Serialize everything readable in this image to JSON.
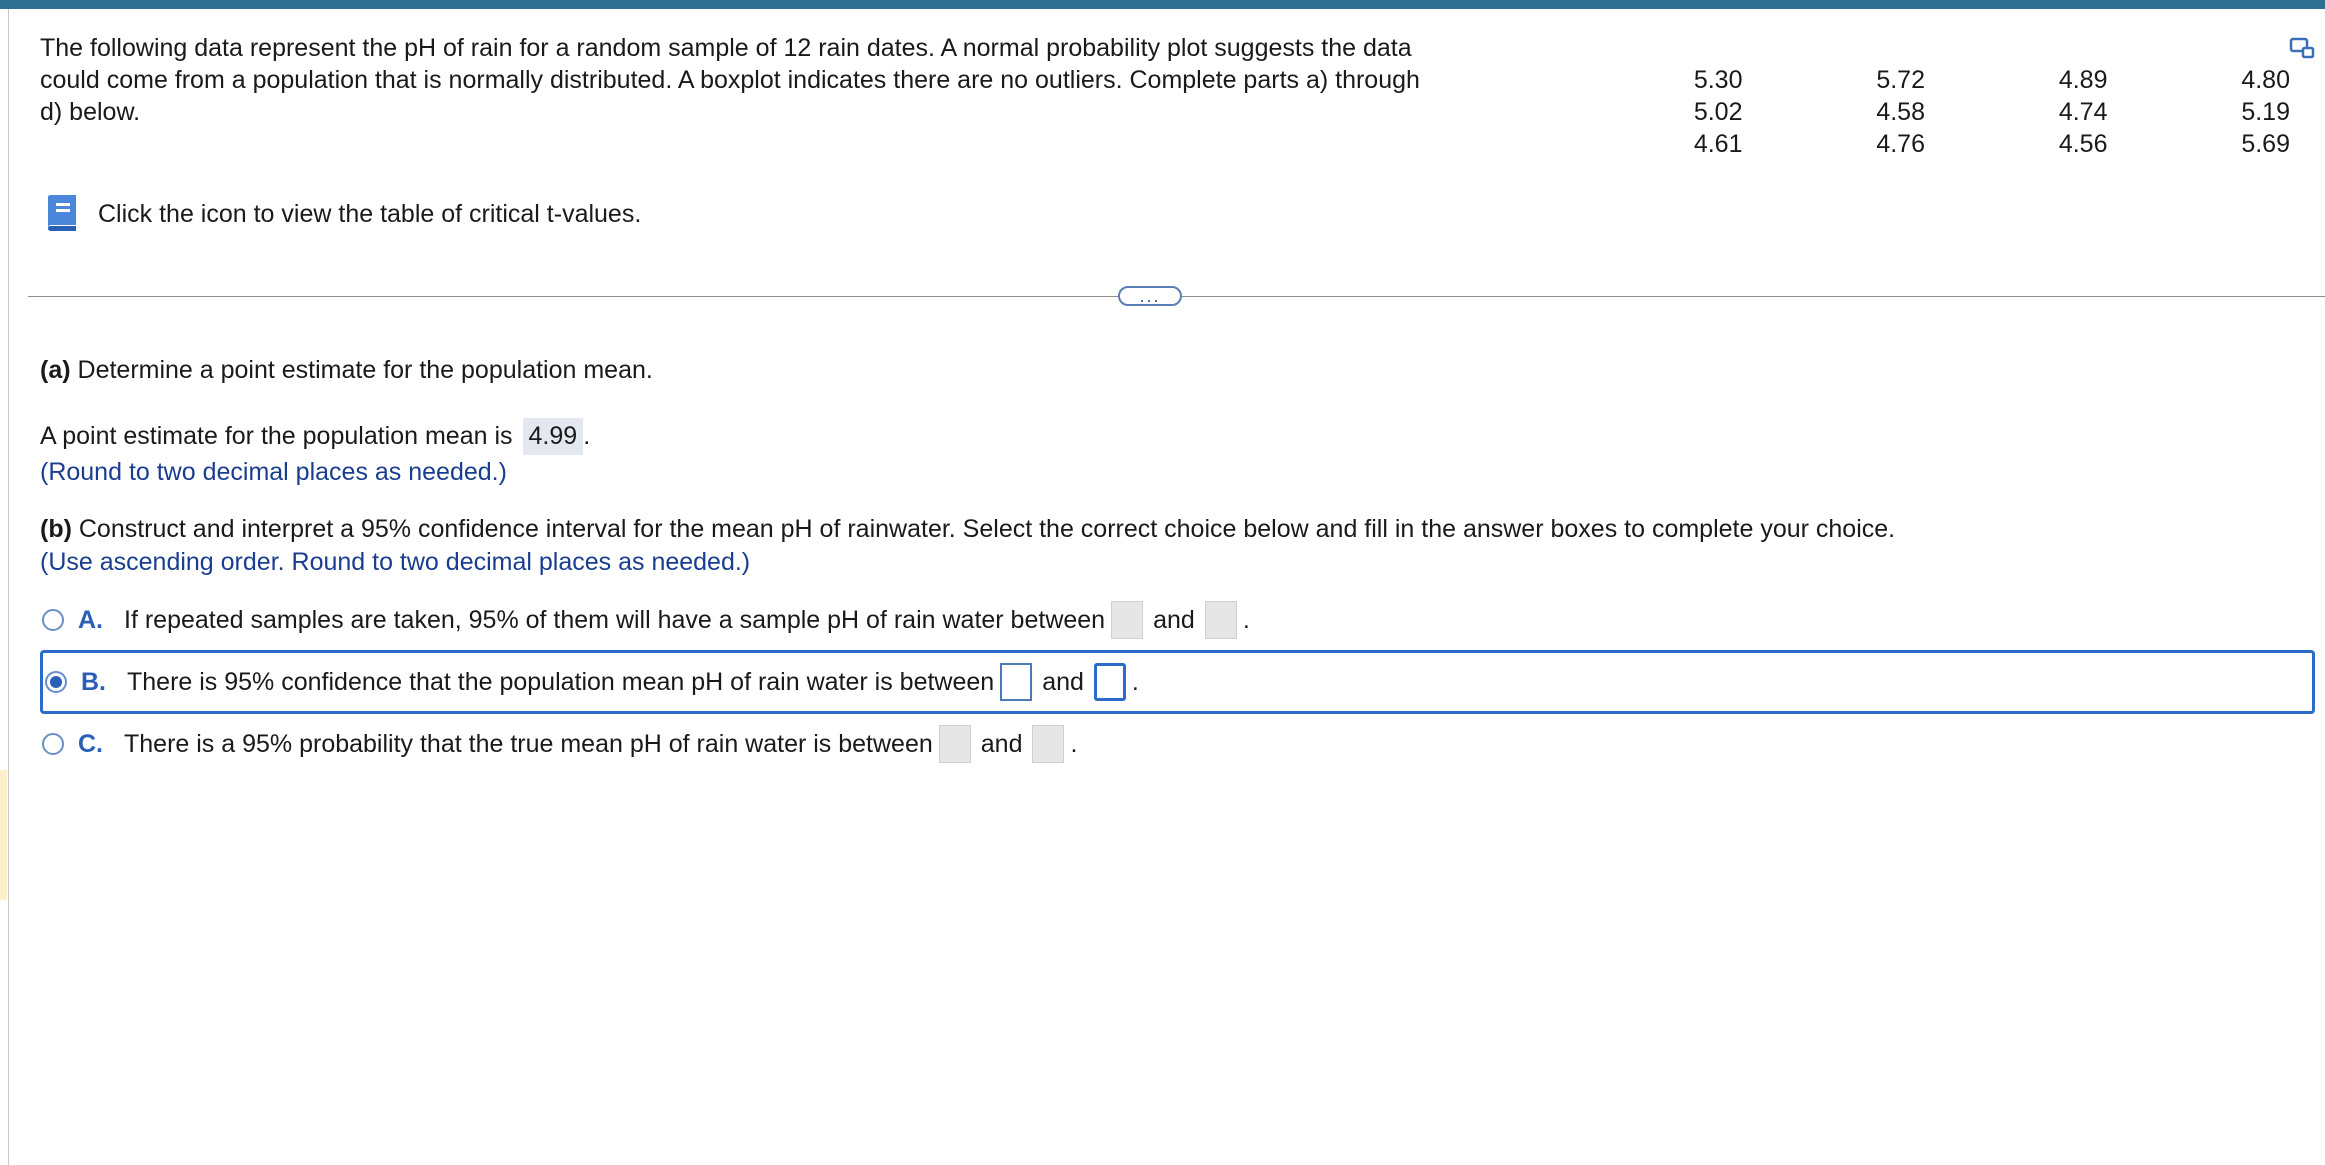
{
  "intro": {
    "text": "The following data represent the pH of rain for a random sample of 12 rain dates. A normal probability plot suggests the data could come from a population that is normally distributed. A boxplot indicates there are no outliers. Complete parts a) through d) below."
  },
  "data_table": {
    "columns": [
      [
        "5.30",
        "5.02",
        "4.61"
      ],
      [
        "5.72",
        "4.58",
        "4.76"
      ],
      [
        "4.89",
        "4.74",
        "4.56"
      ],
      [
        "4.80",
        "5.19",
        "5.69"
      ]
    ]
  },
  "critical_values": {
    "label": "Click the icon to view the table of critical t-values."
  },
  "more": {
    "label": "..."
  },
  "part_a": {
    "prefix": "(a)",
    "question": " Determine a point estimate for the population mean.",
    "answer_prefix": "A point estimate for the population mean is",
    "answer_value": "4.99",
    "answer_suffix": ".",
    "hint": "(Round to two decimal places as needed.)"
  },
  "part_b": {
    "prefix": "(b)",
    "question": " Construct and interpret a 95% confidence interval for the mean pH of rainwater. Select the correct choice below and fill in the answer boxes to complete your choice.",
    "hint": "(Use ascending order. Round to two decimal places as needed.)",
    "choices": [
      {
        "letter": "A.",
        "text": "If repeated samples are taken, 95% of them will have a sample pH of rain water between",
        "and": "and",
        "end": ".",
        "selected": false
      },
      {
        "letter": "B.",
        "text": "There is 95% confidence that the population mean pH of rain water is between",
        "and": "and",
        "end": ".",
        "selected": true
      },
      {
        "letter": "C.",
        "text": "There is a 95% probability that the true mean pH of rain water is between",
        "and": "and",
        "end": ".",
        "selected": false
      }
    ]
  },
  "icons": {
    "book": "book-icon",
    "top_right": "expand-window-icon",
    "radio": "radio-icon"
  },
  "colors": {
    "accent": "#2a6cc7",
    "hint": "#1a3e8f",
    "top_bar": "#2f6f8f"
  }
}
